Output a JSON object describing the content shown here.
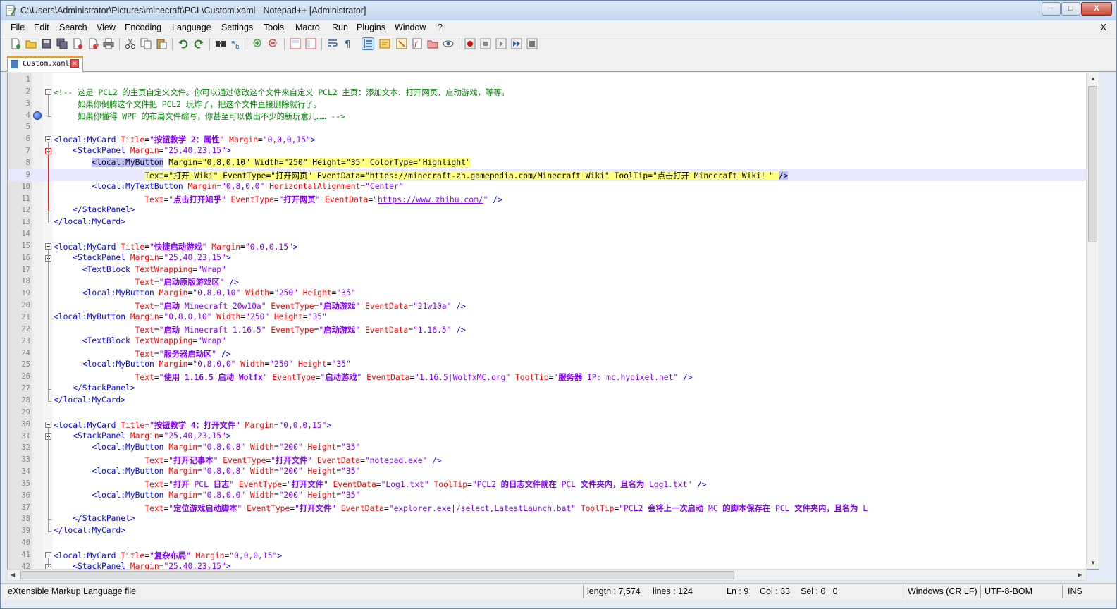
{
  "window": {
    "title": "C:\\Users\\Administrator\\Pictures\\minecraft\\PCL\\Custom.xaml - Notepad++ [Administrator]",
    "minimize": "─",
    "maximize": "□",
    "close": "X"
  },
  "menu": {
    "items": [
      "File",
      "Edit",
      "Search",
      "View",
      "Encoding",
      "Language",
      "Settings",
      "Tools",
      "Macro",
      "Run",
      "Plugins",
      "Window",
      "?"
    ],
    "close": "X"
  },
  "tab": {
    "label": "Custom.xaml",
    "close": "×"
  },
  "editor": {
    "line_numbers": [
      "1",
      "2",
      "3",
      "4",
      "5",
      "6",
      "7",
      "8",
      "9",
      "10",
      "11",
      "12",
      "13",
      "14",
      "15",
      "16",
      "17",
      "18",
      "19",
      "20",
      "21",
      "22",
      "23",
      "24",
      "25",
      "26",
      "27",
      "28",
      "29",
      "30",
      "31",
      "32",
      "33",
      "34",
      "35",
      "36",
      "37",
      "38",
      "39",
      "40",
      "41",
      "42"
    ],
    "current_line": 9,
    "bookmark_line": 4,
    "lines": [
      [],
      [
        [
          "c",
          "<!-- 这是 PCL2 的主页自定义文件。你可以通过修改这个文件来自定义 PCL2 主页：添加文本、打开网页、启动游戏，等等。"
        ]
      ],
      [
        [
          "c",
          "     如果你倒腾这个文件把 PCL2 玩炸了，把这个文件直接删除就行了。"
        ]
      ],
      [
        [
          "c",
          "     如果你懂得 WPF 的布局文件编写，你甚至可以做出不少的新玩意儿…… -->"
        ]
      ],
      [],
      [
        [
          "t",
          "<local:MyCard "
        ],
        [
          "a",
          "Title"
        ],
        [
          "k",
          "="
        ],
        [
          "v",
          "\""
        ],
        [
          "vb",
          "按钮教学 2：属性"
        ],
        [
          "v",
          "\" "
        ],
        [
          "a",
          "Margin"
        ],
        [
          "k",
          "="
        ],
        [
          "v",
          "\"0,0,0,15\""
        ],
        [
          "t",
          ">"
        ]
      ],
      [
        [
          "t",
          "    <StackPanel "
        ],
        [
          "a",
          "Margin"
        ],
        [
          "k",
          "="
        ],
        [
          "v",
          "\"25,40,23,15\""
        ],
        [
          "t",
          ">"
        ]
      ],
      [
        [
          "k",
          "        "
        ],
        [
          "hlt",
          "<local:MyButton"
        ],
        [
          "k",
          " "
        ],
        [
          "hl",
          "Margin=\"0,8,0,10\" Width=\"250\" Height=\"35\" ColorType=\"Highlight\""
        ]
      ],
      [
        [
          "k",
          "                   "
        ],
        [
          "hl",
          "Text=\"打开 Wiki\" EventType=\"打开网页\" EventData=\"https://minecraft-zh.gamepedia.com/Minecraft_Wiki\" ToolTip=\"点击打开 Minecraft Wiki！\" "
        ],
        [
          "hlt",
          "/>"
        ]
      ],
      [
        [
          "t",
          "        <local:MyTextButton "
        ],
        [
          "a",
          "Margin"
        ],
        [
          "k",
          "="
        ],
        [
          "v",
          "\"0,8,0,0\" "
        ],
        [
          "a",
          "HorizontalAlignment"
        ],
        [
          "k",
          "="
        ],
        [
          "v",
          "\"Center\""
        ]
      ],
      [
        [
          "k",
          "                   "
        ],
        [
          "a",
          "Text"
        ],
        [
          "k",
          "="
        ],
        [
          "v",
          "\""
        ],
        [
          "vb",
          "点击打开知乎"
        ],
        [
          "v",
          "\" "
        ],
        [
          "a",
          "EventType"
        ],
        [
          "k",
          "="
        ],
        [
          "v",
          "\""
        ],
        [
          "vb",
          "打开网页"
        ],
        [
          "v",
          "\" "
        ],
        [
          "a",
          "EventData"
        ],
        [
          "k",
          "="
        ],
        [
          "v",
          "\""
        ],
        [
          "u",
          "https://www.zhihu.com/"
        ],
        [
          "v",
          "\" "
        ],
        [
          "t",
          "/>"
        ]
      ],
      [
        [
          "t",
          "    </StackPanel>"
        ]
      ],
      [
        [
          "t",
          "</local:MyCard>"
        ]
      ],
      [],
      [
        [
          "t",
          "<local:MyCard "
        ],
        [
          "a",
          "Title"
        ],
        [
          "k",
          "="
        ],
        [
          "v",
          "\""
        ],
        [
          "vb",
          "快捷启动游戏"
        ],
        [
          "v",
          "\" "
        ],
        [
          "a",
          "Margin"
        ],
        [
          "k",
          "="
        ],
        [
          "v",
          "\"0,0,0,15\""
        ],
        [
          "t",
          ">"
        ]
      ],
      [
        [
          "t",
          "    <StackPanel "
        ],
        [
          "a",
          "Margin"
        ],
        [
          "k",
          "="
        ],
        [
          "v",
          "\"25,40,23,15\""
        ],
        [
          "t",
          ">"
        ]
      ],
      [
        [
          "t",
          "      <TextBlock "
        ],
        [
          "a",
          "TextWrapping"
        ],
        [
          "k",
          "="
        ],
        [
          "v",
          "\"Wrap\""
        ]
      ],
      [
        [
          "k",
          "                 "
        ],
        [
          "a",
          "Text"
        ],
        [
          "k",
          "="
        ],
        [
          "v",
          "\""
        ],
        [
          "vb",
          "启动原版游戏区"
        ],
        [
          "v",
          "\" "
        ],
        [
          "t",
          "/>"
        ]
      ],
      [
        [
          "t",
          "      <local:MyButton "
        ],
        [
          "a",
          "Margin"
        ],
        [
          "k",
          "="
        ],
        [
          "v",
          "\"0,8,0,10\" "
        ],
        [
          "a",
          "Width"
        ],
        [
          "k",
          "="
        ],
        [
          "v",
          "\"250\" "
        ],
        [
          "a",
          "Height"
        ],
        [
          "k",
          "="
        ],
        [
          "v",
          "\"35\""
        ]
      ],
      [
        [
          "k",
          "                 "
        ],
        [
          "a",
          "Text"
        ],
        [
          "k",
          "="
        ],
        [
          "v",
          "\""
        ],
        [
          "vb",
          "启动"
        ],
        [
          "v",
          " Minecraft 20w10a\" "
        ],
        [
          "a",
          "EventType"
        ],
        [
          "k",
          "="
        ],
        [
          "v",
          "\""
        ],
        [
          "vb",
          "启动游戏"
        ],
        [
          "v",
          "\" "
        ],
        [
          "a",
          "EventData"
        ],
        [
          "k",
          "="
        ],
        [
          "v",
          "\"21w10a\" "
        ],
        [
          "t",
          "/>"
        ]
      ],
      [
        [
          "t",
          "<local:MyButton "
        ],
        [
          "a",
          "Margin"
        ],
        [
          "k",
          "="
        ],
        [
          "v",
          "\"0,8,0,10\" "
        ],
        [
          "a",
          "Width"
        ],
        [
          "k",
          "="
        ],
        [
          "v",
          "\"250\" "
        ],
        [
          "a",
          "Height"
        ],
        [
          "k",
          "="
        ],
        [
          "v",
          "\"35\""
        ]
      ],
      [
        [
          "k",
          "                 "
        ],
        [
          "a",
          "Text"
        ],
        [
          "k",
          "="
        ],
        [
          "v",
          "\""
        ],
        [
          "vb",
          "启动"
        ],
        [
          "v",
          " Minecraft 1.16.5\" "
        ],
        [
          "a",
          "EventType"
        ],
        [
          "k",
          "="
        ],
        [
          "v",
          "\""
        ],
        [
          "vb",
          "启动游戏"
        ],
        [
          "v",
          "\" "
        ],
        [
          "a",
          "EventData"
        ],
        [
          "k",
          "="
        ],
        [
          "v",
          "\"1.16.5\" "
        ],
        [
          "t",
          "/>"
        ]
      ],
      [
        [
          "t",
          "      <TextBlock "
        ],
        [
          "a",
          "TextWrapping"
        ],
        [
          "k",
          "="
        ],
        [
          "v",
          "\"Wrap\""
        ]
      ],
      [
        [
          "k",
          "                 "
        ],
        [
          "a",
          "Text"
        ],
        [
          "k",
          "="
        ],
        [
          "v",
          "\""
        ],
        [
          "vb",
          "服务器启动区"
        ],
        [
          "v",
          "\" "
        ],
        [
          "t",
          "/>"
        ]
      ],
      [
        [
          "t",
          "      <local:MyButton "
        ],
        [
          "a",
          "Margin"
        ],
        [
          "k",
          "="
        ],
        [
          "v",
          "\"0,8,0,0\" "
        ],
        [
          "a",
          "Width"
        ],
        [
          "k",
          "="
        ],
        [
          "v",
          "\"250\" "
        ],
        [
          "a",
          "Height"
        ],
        [
          "k",
          "="
        ],
        [
          "v",
          "\"35\""
        ]
      ],
      [
        [
          "k",
          "                 "
        ],
        [
          "a",
          "Text"
        ],
        [
          "k",
          "="
        ],
        [
          "v",
          "\""
        ],
        [
          "vb",
          "使用 1.16.5 启动 Wolfx"
        ],
        [
          "v",
          "\" "
        ],
        [
          "a",
          "EventType"
        ],
        [
          "k",
          "="
        ],
        [
          "v",
          "\""
        ],
        [
          "vb",
          "启动游戏"
        ],
        [
          "v",
          "\" "
        ],
        [
          "a",
          "EventData"
        ],
        [
          "k",
          "="
        ],
        [
          "v",
          "\"1.16.5|WolfxMC.org\" "
        ],
        [
          "a",
          "ToolTip"
        ],
        [
          "k",
          "="
        ],
        [
          "v",
          "\""
        ],
        [
          "vb",
          "服务器"
        ],
        [
          "v",
          " IP: mc.hypixel.net\" "
        ],
        [
          "t",
          "/>"
        ]
      ],
      [
        [
          "t",
          "    </StackPanel>"
        ]
      ],
      [
        [
          "t",
          "</local:MyCard>"
        ]
      ],
      [],
      [
        [
          "t",
          "<local:MyCard "
        ],
        [
          "a",
          "Title"
        ],
        [
          "k",
          "="
        ],
        [
          "v",
          "\""
        ],
        [
          "vb",
          "按钮教学 4：打开文件"
        ],
        [
          "v",
          "\" "
        ],
        [
          "a",
          "Margin"
        ],
        [
          "k",
          "="
        ],
        [
          "v",
          "\"0,0,0,15\""
        ],
        [
          "t",
          ">"
        ]
      ],
      [
        [
          "t",
          "    <StackPanel "
        ],
        [
          "a",
          "Margin"
        ],
        [
          "k",
          "="
        ],
        [
          "v",
          "\"25,40,23,15\""
        ],
        [
          "t",
          ">"
        ]
      ],
      [
        [
          "t",
          "        <local:MyButton "
        ],
        [
          "a",
          "Margin"
        ],
        [
          "k",
          "="
        ],
        [
          "v",
          "\"0,8,0,8\" "
        ],
        [
          "a",
          "Width"
        ],
        [
          "k",
          "="
        ],
        [
          "v",
          "\"200\" "
        ],
        [
          "a",
          "Height"
        ],
        [
          "k",
          "="
        ],
        [
          "v",
          "\"35\""
        ]
      ],
      [
        [
          "k",
          "                   "
        ],
        [
          "a",
          "Text"
        ],
        [
          "k",
          "="
        ],
        [
          "v",
          "\""
        ],
        [
          "vb",
          "打开记事本"
        ],
        [
          "v",
          "\" "
        ],
        [
          "a",
          "EventType"
        ],
        [
          "k",
          "="
        ],
        [
          "v",
          "\""
        ],
        [
          "vb",
          "打开文件"
        ],
        [
          "v",
          "\" "
        ],
        [
          "a",
          "EventData"
        ],
        [
          "k",
          "="
        ],
        [
          "v",
          "\"notepad.exe\" "
        ],
        [
          "t",
          "/>"
        ]
      ],
      [
        [
          "t",
          "        <local:MyButton "
        ],
        [
          "a",
          "Margin"
        ],
        [
          "k",
          "="
        ],
        [
          "v",
          "\"0,8,0,8\" "
        ],
        [
          "a",
          "Width"
        ],
        [
          "k",
          "="
        ],
        [
          "v",
          "\"200\" "
        ],
        [
          "a",
          "Height"
        ],
        [
          "k",
          "="
        ],
        [
          "v",
          "\"35\""
        ]
      ],
      [
        [
          "k",
          "                   "
        ],
        [
          "a",
          "Text"
        ],
        [
          "k",
          "="
        ],
        [
          "v",
          "\""
        ],
        [
          "vb",
          "打开"
        ],
        [
          "v",
          " PCL "
        ],
        [
          "vb",
          "日志"
        ],
        [
          "v",
          "\" "
        ],
        [
          "a",
          "EventType"
        ],
        [
          "k",
          "="
        ],
        [
          "v",
          "\""
        ],
        [
          "vb",
          "打开文件"
        ],
        [
          "v",
          "\" "
        ],
        [
          "a",
          "EventData"
        ],
        [
          "k",
          "="
        ],
        [
          "v",
          "\"Log1.txt\" "
        ],
        [
          "a",
          "ToolTip"
        ],
        [
          "k",
          "="
        ],
        [
          "v",
          "\"PCL2 "
        ],
        [
          "vb",
          "的日志文件就在"
        ],
        [
          "v",
          " PCL "
        ],
        [
          "vb",
          "文件夹内，且名为"
        ],
        [
          "v",
          " Log1.txt\" "
        ],
        [
          "t",
          "/>"
        ]
      ],
      [
        [
          "t",
          "        <local:MyButton "
        ],
        [
          "a",
          "Margin"
        ],
        [
          "k",
          "="
        ],
        [
          "v",
          "\"0,8,0,0\" "
        ],
        [
          "a",
          "Width"
        ],
        [
          "k",
          "="
        ],
        [
          "v",
          "\"200\" "
        ],
        [
          "a",
          "Height"
        ],
        [
          "k",
          "="
        ],
        [
          "v",
          "\"35\""
        ]
      ],
      [
        [
          "k",
          "                   "
        ],
        [
          "a",
          "Text"
        ],
        [
          "k",
          "="
        ],
        [
          "v",
          "\""
        ],
        [
          "vb",
          "定位游戏启动脚本"
        ],
        [
          "v",
          "\" "
        ],
        [
          "a",
          "EventType"
        ],
        [
          "k",
          "="
        ],
        [
          "v",
          "\""
        ],
        [
          "vb",
          "打开文件"
        ],
        [
          "v",
          "\" "
        ],
        [
          "a",
          "EventData"
        ],
        [
          "k",
          "="
        ],
        [
          "v",
          "\"explorer.exe|/select,LatestLaunch.bat\" "
        ],
        [
          "a",
          "ToolTip"
        ],
        [
          "k",
          "="
        ],
        [
          "v",
          "\"PCL2 "
        ],
        [
          "vb",
          "会将上一次启动"
        ],
        [
          "v",
          " MC "
        ],
        [
          "vb",
          "的脚本保存在"
        ],
        [
          "v",
          " PCL "
        ],
        [
          "vb",
          "文件夹内，且名为"
        ],
        [
          "v",
          " L"
        ]
      ],
      [
        [
          "t",
          "    </StackPanel>"
        ]
      ],
      [
        [
          "t",
          "</local:MyCard>"
        ]
      ],
      [],
      [
        [
          "t",
          "<local:MyCard "
        ],
        [
          "a",
          "Title"
        ],
        [
          "k",
          "="
        ],
        [
          "v",
          "\""
        ],
        [
          "vb",
          "复杂布局"
        ],
        [
          "v",
          "\" "
        ],
        [
          "a",
          "Margin"
        ],
        [
          "k",
          "="
        ],
        [
          "v",
          "\"0,0,0,15\""
        ],
        [
          "t",
          ">"
        ]
      ],
      [
        [
          "t",
          "    <StackPanel "
        ],
        [
          "a",
          "Margin"
        ],
        [
          "k",
          "="
        ],
        [
          "v",
          "\"25,40,23,15\""
        ],
        [
          "t",
          ">"
        ]
      ]
    ]
  },
  "status": {
    "file_type": "eXtensible Markup Language file",
    "length": "length : 7,574",
    "lines": "lines : 124",
    "ln": "Ln : 9",
    "col": "Col : 33",
    "sel": "Sel : 0 | 0",
    "eol": "Windows (CR LF)",
    "encoding": "UTF-8-BOM",
    "mode": "INS"
  },
  "colors": {
    "tag": "#0000ff",
    "attribute": "#ff0000",
    "value": "#8000ff",
    "comment": "#008000",
    "current_line": "#e8e8ff",
    "highlight": "#ffff80",
    "tab_accent": "#fa9b15"
  },
  "toolbar_icons": [
    "new-file-icon",
    "open-file-icon",
    "save-icon",
    "save-all-icon",
    "close-icon",
    "close-all-icon",
    "print-icon",
    "cut-icon",
    "copy-icon",
    "paste-icon",
    "undo-icon",
    "redo-icon",
    "find-icon",
    "replace-icon",
    "zoom-in-icon",
    "zoom-out-icon",
    "sync-vertical-icon",
    "sync-horizontal-icon",
    "word-wrap-icon",
    "show-all-chars-icon",
    "indent-guide-icon",
    "user-language-icon",
    "doc-map-icon",
    "function-list-icon",
    "folder-workspace-icon",
    "monitoring-icon",
    "record-macro-icon",
    "stop-macro-icon",
    "play-macro-icon",
    "run-macro-multiple-icon",
    "save-macro-icon"
  ]
}
